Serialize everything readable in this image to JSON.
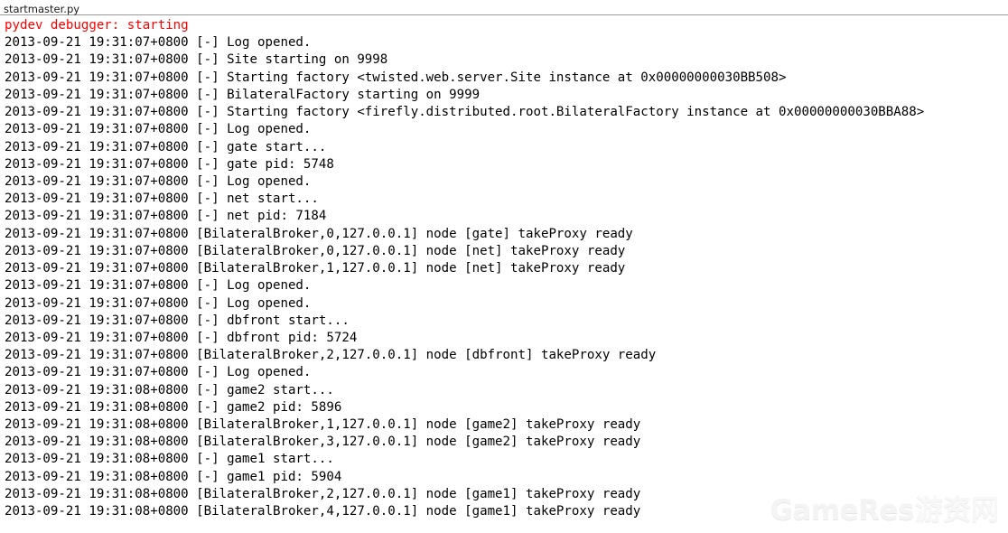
{
  "window": {
    "tab_label": "startmaster.py"
  },
  "console": {
    "lines": [
      {
        "text": "pydev debugger: starting",
        "level": "error"
      },
      {
        "text": "2013-09-21 19:31:07+0800 [-] Log opened.",
        "level": "info"
      },
      {
        "text": "2013-09-21 19:31:07+0800 [-] Site starting on 9998",
        "level": "info"
      },
      {
        "text": "2013-09-21 19:31:07+0800 [-] Starting factory <twisted.web.server.Site instance at 0x00000000030BB508>",
        "level": "info"
      },
      {
        "text": "2013-09-21 19:31:07+0800 [-] BilateralFactory starting on 9999",
        "level": "info"
      },
      {
        "text": "2013-09-21 19:31:07+0800 [-] Starting factory <firefly.distributed.root.BilateralFactory instance at 0x00000000030BBA88>",
        "level": "info"
      },
      {
        "text": "2013-09-21 19:31:07+0800 [-] Log opened.",
        "level": "info"
      },
      {
        "text": "2013-09-21 19:31:07+0800 [-] gate start...",
        "level": "info"
      },
      {
        "text": "2013-09-21 19:31:07+0800 [-] gate pid: 5748",
        "level": "info"
      },
      {
        "text": "2013-09-21 19:31:07+0800 [-] Log opened.",
        "level": "info"
      },
      {
        "text": "2013-09-21 19:31:07+0800 [-] net start...",
        "level": "info"
      },
      {
        "text": "2013-09-21 19:31:07+0800 [-] net pid: 7184",
        "level": "info"
      },
      {
        "text": "2013-09-21 19:31:07+0800 [BilateralBroker,0,127.0.0.1] node [gate] takeProxy ready",
        "level": "info"
      },
      {
        "text": "2013-09-21 19:31:07+0800 [BilateralBroker,0,127.0.0.1] node [net] takeProxy ready",
        "level": "info"
      },
      {
        "text": "2013-09-21 19:31:07+0800 [BilateralBroker,1,127.0.0.1] node [net] takeProxy ready",
        "level": "info"
      },
      {
        "text": "2013-09-21 19:31:07+0800 [-] Log opened.",
        "level": "info"
      },
      {
        "text": "2013-09-21 19:31:07+0800 [-] Log opened.",
        "level": "info"
      },
      {
        "text": "2013-09-21 19:31:07+0800 [-] dbfront start...",
        "level": "info"
      },
      {
        "text": "2013-09-21 19:31:07+0800 [-] dbfront pid: 5724",
        "level": "info"
      },
      {
        "text": "2013-09-21 19:31:07+0800 [BilateralBroker,2,127.0.0.1] node [dbfront] takeProxy ready",
        "level": "info"
      },
      {
        "text": "2013-09-21 19:31:07+0800 [-] Log opened.",
        "level": "info"
      },
      {
        "text": "2013-09-21 19:31:08+0800 [-] game2 start...",
        "level": "info"
      },
      {
        "text": "2013-09-21 19:31:08+0800 [-] game2 pid: 5896",
        "level": "info"
      },
      {
        "text": "2013-09-21 19:31:08+0800 [BilateralBroker,1,127.0.0.1] node [game2] takeProxy ready",
        "level": "info"
      },
      {
        "text": "2013-09-21 19:31:08+0800 [BilateralBroker,3,127.0.0.1] node [game2] takeProxy ready",
        "level": "info"
      },
      {
        "text": "2013-09-21 19:31:08+0800 [-] game1 start...",
        "level": "info"
      },
      {
        "text": "2013-09-21 19:31:08+0800 [-] game1 pid: 5904",
        "level": "info"
      },
      {
        "text": "2013-09-21 19:31:08+0800 [BilateralBroker,2,127.0.0.1] node [game1] takeProxy ready",
        "level": "info"
      },
      {
        "text": "2013-09-21 19:31:08+0800 [BilateralBroker,4,127.0.0.1] node [game1] takeProxy ready",
        "level": "info"
      }
    ]
  },
  "watermark": {
    "latin": "GameRes",
    "cjk": "游资网"
  },
  "colors": {
    "error_text": "#ff0000",
    "info_text": "#000000",
    "background": "#ffffff",
    "tab_divider": "#9a9a9a",
    "watermark": "#f4f4f4"
  }
}
